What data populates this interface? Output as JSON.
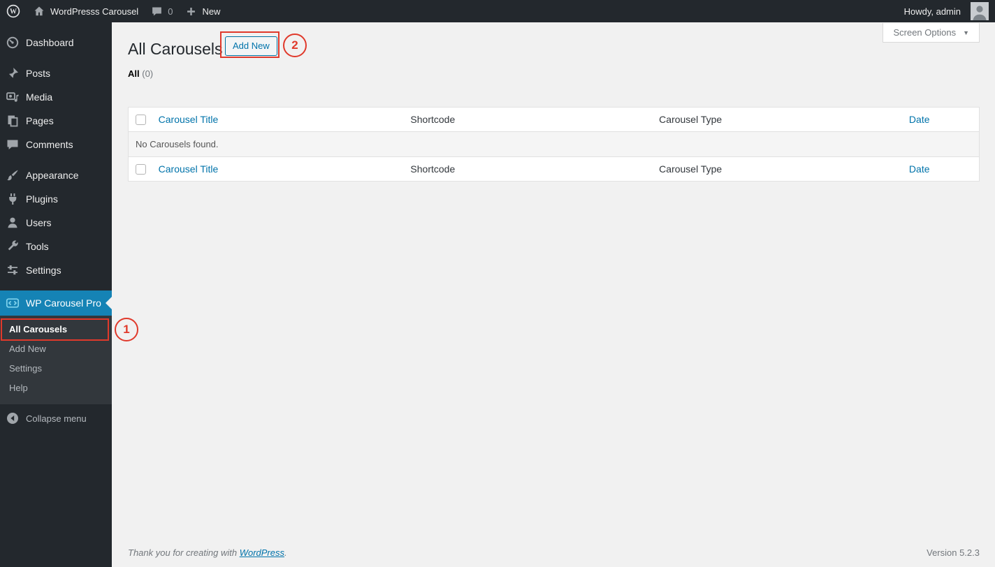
{
  "admin_bar": {
    "site_name": "WordPresss Carousel",
    "comments_count": "0",
    "new_label": "New",
    "howdy": "Howdy, admin"
  },
  "sidebar": {
    "items": [
      {
        "label": "Dashboard"
      },
      {
        "label": "Posts"
      },
      {
        "label": "Media"
      },
      {
        "label": "Pages"
      },
      {
        "label": "Comments"
      },
      {
        "label": "Appearance"
      },
      {
        "label": "Plugins"
      },
      {
        "label": "Users"
      },
      {
        "label": "Tools"
      },
      {
        "label": "Settings"
      },
      {
        "label": "WP Carousel Pro"
      }
    ],
    "submenu": [
      {
        "label": "All Carousels",
        "current": true
      },
      {
        "label": "Add New",
        "current": false
      },
      {
        "label": "Settings",
        "current": false
      },
      {
        "label": "Help",
        "current": false
      }
    ],
    "collapse_label": "Collapse menu"
  },
  "page": {
    "title": "All Carousels",
    "add_new_label": "Add New",
    "screen_options_label": "Screen Options",
    "filter_all_label": "All",
    "filter_all_count": "(0)"
  },
  "table": {
    "columns": [
      "Carousel Title",
      "Shortcode",
      "Carousel Type",
      "Date"
    ],
    "empty_message": "No Carousels found."
  },
  "annotations": {
    "step1": "1",
    "step2": "2"
  },
  "footer": {
    "thanks_prefix": "Thank you for creating with ",
    "thanks_link": "WordPress",
    "thanks_suffix": ".",
    "version": "Version 5.2.3"
  },
  "colors": {
    "admin_dark": "#23282d",
    "submenu_dark": "#32373c",
    "active_menu_blue": "#1583b5",
    "link_blue": "#0073aa",
    "annotation_red": "#e0392b",
    "content_bg": "#f1f1f1"
  }
}
